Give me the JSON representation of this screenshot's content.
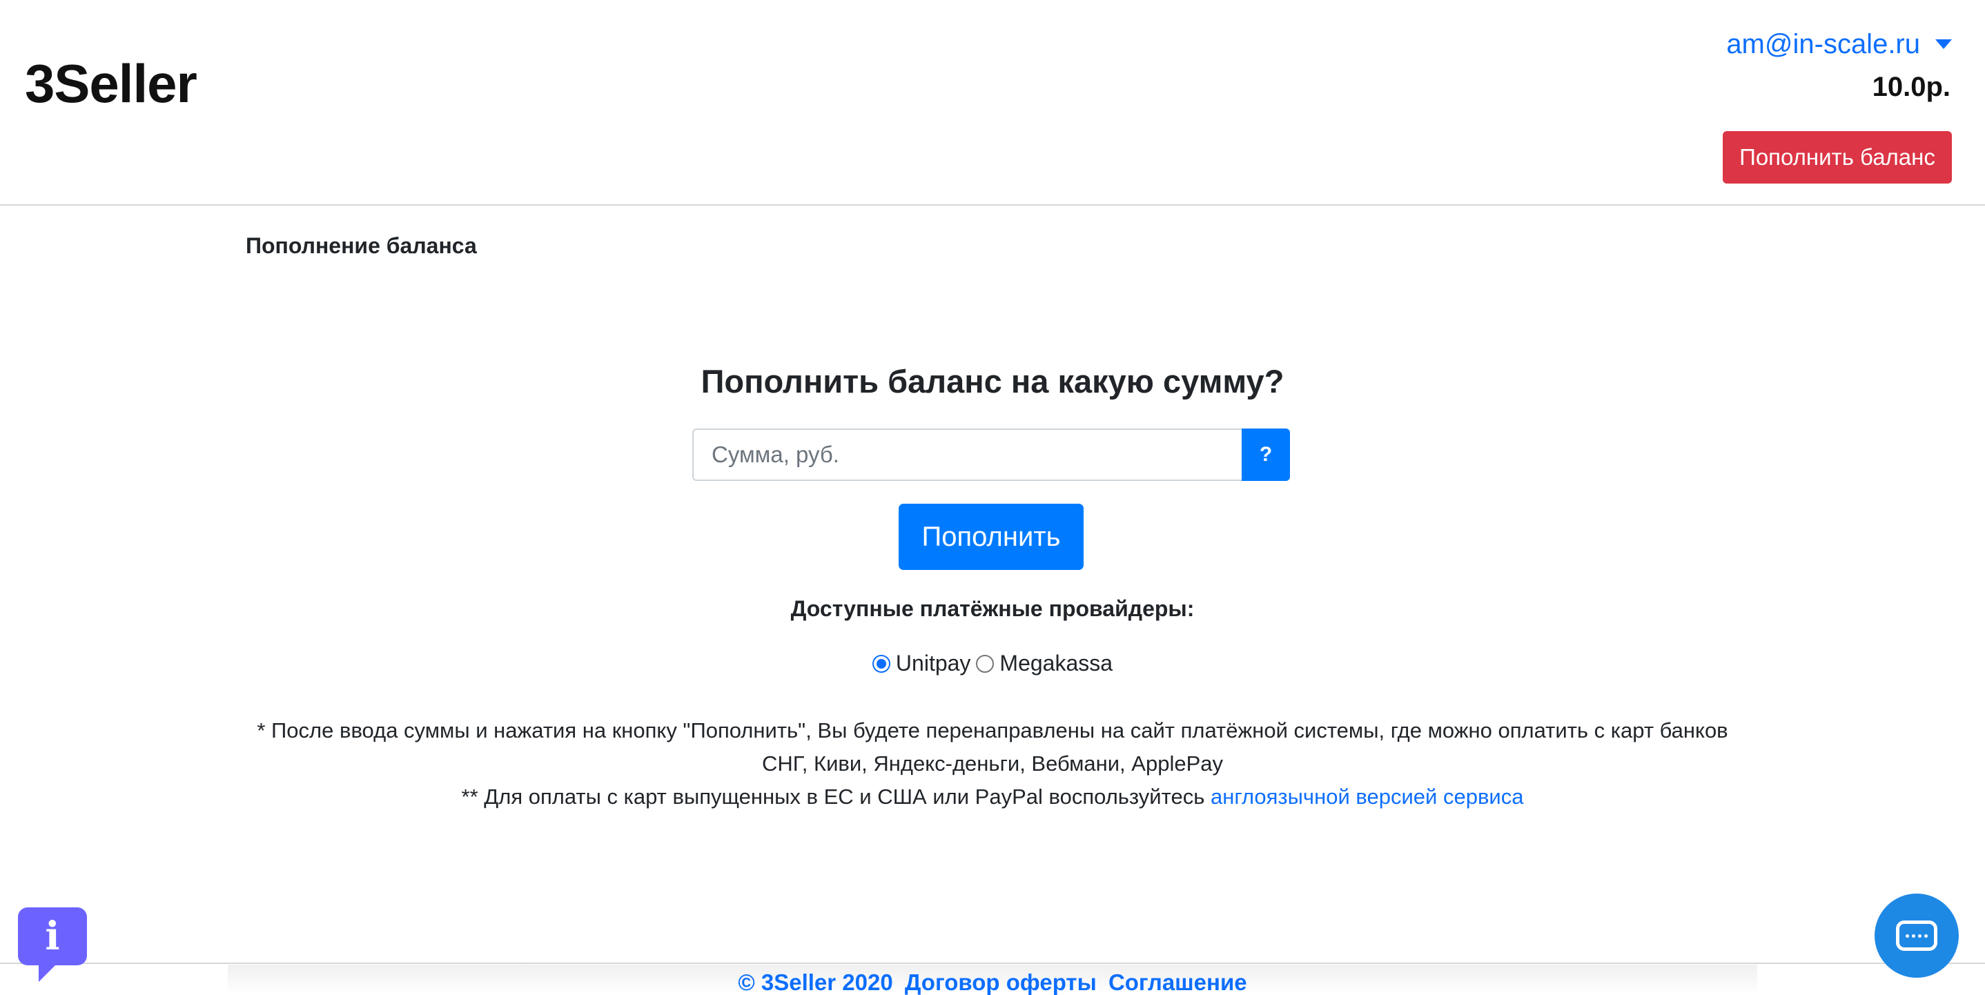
{
  "header": {
    "logo": "3Seller",
    "user_email": "am@in-scale.ru",
    "balance": "10.0р.",
    "topup_button": "Пополнить баланс"
  },
  "page": {
    "section_title": "Пополнение баланса",
    "question": "Пополнить баланс на какую сумму?",
    "amount_placeholder": "Сумма, руб.",
    "help_button": "?",
    "submit_button": "Пополнить",
    "providers_title": "Доступные платёжные провайдеры:",
    "providers": [
      {
        "label": "Unitpay",
        "selected": true
      },
      {
        "label": "Megakassa",
        "selected": false
      }
    ],
    "note_line1": "* После ввода суммы и нажатия на кнопку \"Пополнить\", Вы будете перенаправлены на сайт платёжной системы, где можно оплатить с карт банков СНГ, Киви, Яндекс-деньги, Вебмани, ApplePay",
    "note_line2_prefix": "** Для оплаты с карт выпущенных в ЕС и США или PayPal воспользуйтесь",
    "note_line2_link": "англоязычной версией сервиса"
  },
  "footer": {
    "copyright": "© 3Seller 2020",
    "offer_link": "Договор оферты",
    "agreement_link": "Соглашение"
  },
  "widgets": {
    "info_icon": "i",
    "chat_icon": "chat-icon"
  },
  "colors": {
    "primary": "#007bff",
    "danger": "#dc3545",
    "link": "#0d6efd",
    "info_widget": "#6c63ff",
    "chat_widget": "#1e88e5"
  }
}
